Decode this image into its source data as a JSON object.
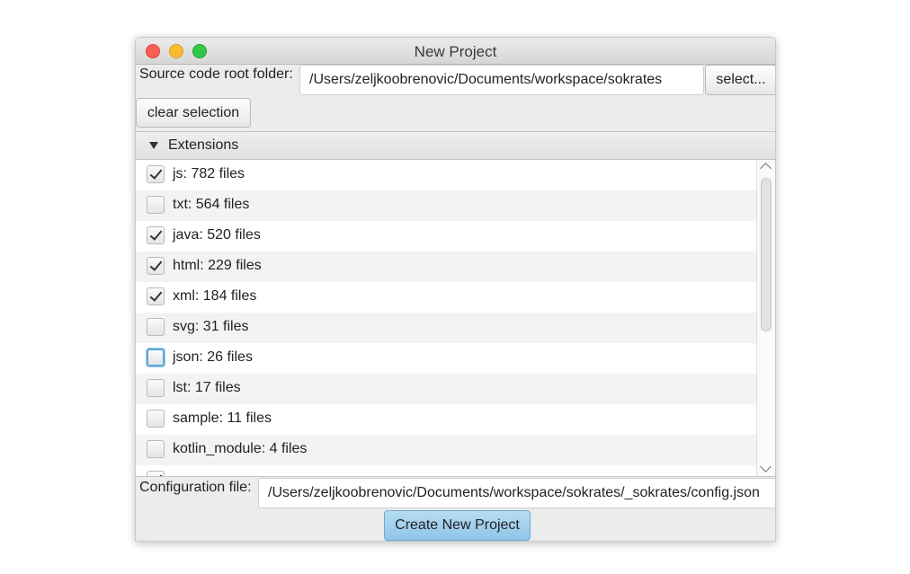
{
  "window": {
    "title": "New Project"
  },
  "source": {
    "label": "Source code root folder:",
    "path": "/Users/zeljkoobrenovic/Documents/workspace/sokrates",
    "select_label": "select...",
    "clear_label": "clear selection"
  },
  "extensions": {
    "title": "Extensions",
    "items": [
      {
        "label": "js: 782 files",
        "checked": true
      },
      {
        "label": "txt: 564 files",
        "checked": false
      },
      {
        "label": "java: 520 files",
        "checked": true
      },
      {
        "label": "html: 229 files",
        "checked": true
      },
      {
        "label": "xml: 184 files",
        "checked": true
      },
      {
        "label": "svg: 31 files",
        "checked": false
      },
      {
        "label": "json: 26 files",
        "checked": false,
        "focused": true
      },
      {
        "label": "lst: 17 files",
        "checked": false
      },
      {
        "label": "sample: 11 files",
        "checked": false
      },
      {
        "label": "kotlin_module: 4 files",
        "checked": false
      },
      {
        "label": "",
        "checked": true
      }
    ]
  },
  "config": {
    "label": "Configuration file:",
    "path": "/Users/zeljkoobrenovic/Documents/workspace/sokrates/_sokrates/config.json"
  },
  "actions": {
    "create_label": "Create New Project"
  }
}
